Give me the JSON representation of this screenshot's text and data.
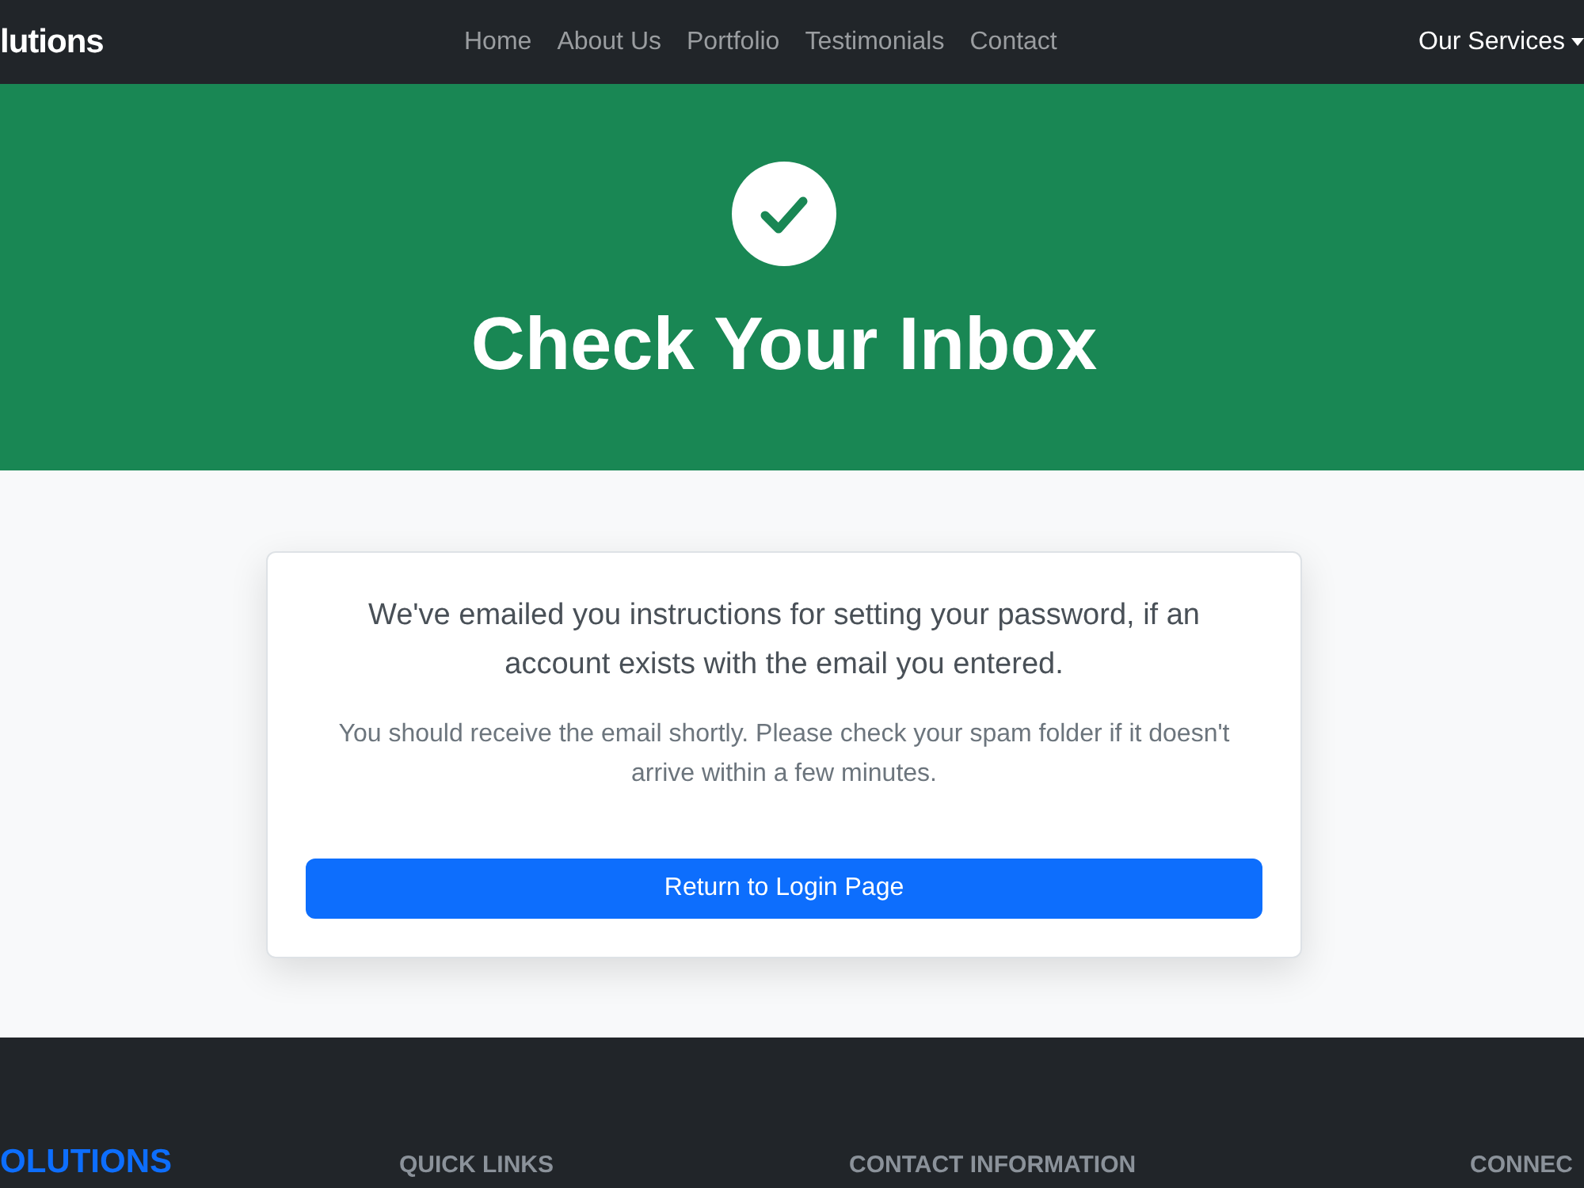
{
  "navbar": {
    "brand": "lutions",
    "links": [
      {
        "label": "Home",
        "selected": false
      },
      {
        "label": "About Us",
        "selected": false
      },
      {
        "label": "Portfolio",
        "selected": false
      },
      {
        "label": "Testimonials",
        "selected": false
      },
      {
        "label": "Contact",
        "selected": false
      }
    ],
    "dropdown": {
      "label": "Our Services",
      "expanded": false
    }
  },
  "hero": {
    "title": "Check Your Inbox"
  },
  "card": {
    "message": "We've emailed you instructions for setting your password, if an account exists with the email you entered.",
    "note": "You should receive the email shortly. Please check your spam folder if it doesn't arrive within a few minutes.",
    "button": "Return to Login Page"
  },
  "footer": {
    "columns": [
      {
        "kind": "brand",
        "heading": "OLUTIONS"
      },
      {
        "kind": "section",
        "heading": "QUICK LINKS"
      },
      {
        "kind": "section",
        "heading": "CONTACT INFORMATION"
      },
      {
        "kind": "section",
        "heading": "CONNEC"
      }
    ]
  }
}
